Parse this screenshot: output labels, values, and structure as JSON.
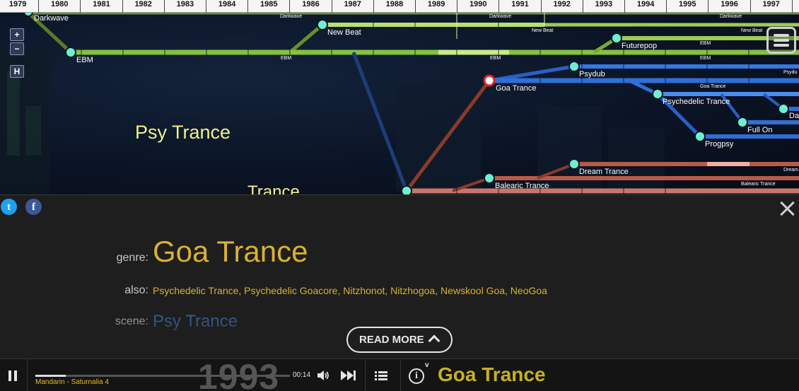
{
  "timeline": {
    "years": [
      "1979",
      "1980",
      "1981",
      "1982",
      "1983",
      "1984",
      "1985",
      "1986",
      "1987",
      "1988",
      "1989",
      "1990",
      "1991",
      "1992",
      "1993",
      "1994",
      "1995",
      "1996",
      "1997"
    ]
  },
  "map": {
    "zoom_in_label": "+",
    "zoom_out_label": "−",
    "home_label": "H",
    "scene_label": "Psy Trance",
    "scene_label_cut": "Trance",
    "nodes": {
      "darkwave": "Darkwave",
      "ebm": "EBM",
      "new_beat": "New Beat",
      "futurepop": "Futurepop",
      "goa_trance": "Goa Trance",
      "psydub": "Psydub",
      "psychedelic_trance": "Psychedelic Trance",
      "full_on": "Full On",
      "da_cut": "Da",
      "progpsy": "Progpsy",
      "dream_trance": "Dream Trance",
      "balearic_trance": "Balearic Trance"
    },
    "line_labels": {
      "darkwave_1": "Darkwave",
      "darkwave_2": "Darkwave",
      "darkwave_3": "Darkwave",
      "newbeat_1": "New Beat",
      "newbeat_2": "New Beat",
      "ebm_1": "EBM",
      "ebm_2": "EBM",
      "ebm_3": "EBM",
      "ebm_4": "EBM",
      "goa_1": "Goa Trance",
      "psydub_1": "Psydu",
      "dream_1": "Dream",
      "balearic_1": "Balearic Trance"
    }
  },
  "info": {
    "genre_key": "genre:",
    "genre": "Goa Trance",
    "also_key": "also:",
    "also": "Psychedelic Trance, Psychedelic Goacore, Nitzhonot, Nitzhogoa, Newskool Goa, NeoGoa",
    "scene_key": "scene:",
    "scene": "Psy Trance",
    "read_more": "READ MORE",
    "twitter_glyph": "t",
    "facebook_glyph": "f"
  },
  "player": {
    "year": "1993",
    "track": "Mandarin - Saturnalia 4",
    "time": "00:14",
    "progress": 0.12,
    "info_glyph": "i",
    "info_caret": "v",
    "now_playing_genre": "Goa Trance"
  },
  "colors": {
    "genre_gold": "#d8b232",
    "scene_blue": "#3a6fb0",
    "ebm_green": "#7fbf3a",
    "psy_blue": "#2f6fd6",
    "trance_red": "#b85a48"
  }
}
